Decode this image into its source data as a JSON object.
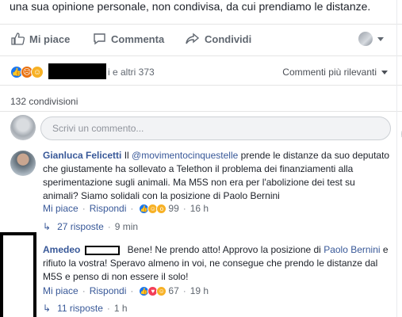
{
  "post": {
    "text_tail": "una sua opinione personale, non condivisa, da cui prendiamo le distanze."
  },
  "actions": {
    "like": "Mi piace",
    "comment": "Commenta",
    "share": "Condividi"
  },
  "reactions": {
    "others": "i e altri 373",
    "sort": "Commenti più rilevanti"
  },
  "shares": "132 condivisioni",
  "composer": {
    "placeholder": "Scrivi un commento..."
  },
  "comments": [
    {
      "author": "Gianluca Felicetti",
      "text_before": " Il ",
      "mention": "@movimentocinquestelle",
      "text_after": " prende le distanze da suo deputato che giustamente ha sollevato a Telethon il problema dei finanziamenti alla sperimentazione sugli animali. Ma M5S non era per l'abolizione dei test su animali? Siamo solidali con la posizione di Paolo Bernini",
      "like": "Mi piace",
      "reply": "Rispondi",
      "reaction_count": "99",
      "time": "16 h",
      "replies": "27 risposte",
      "replies_time": "9 min"
    },
    {
      "author": "Amedeo",
      "text_before": " Bene! Ne prendo atto! Approvo la posizione di ",
      "mention": "Paolo Bernini",
      "text_after": " e rifiuto la vostra! Speravo almeno in voi, ne consegue che prendo le distanze dal M5S e penso di non essere il solo!",
      "like": "Mi piace",
      "reply": "Rispondi",
      "reaction_count": "67",
      "time": "19 h",
      "replies": "11 risposte",
      "replies_time": "1 h"
    }
  ],
  "icons": {
    "like": "thumbs-up-icon",
    "comment": "speech-bubble-icon",
    "share": "share-arrow-icon",
    "emoji": "smiley-icon",
    "camera": "camera-icon",
    "gif": "gif-icon",
    "sticker": "sticker-icon"
  },
  "colors": {
    "link": "#385898",
    "like_blue": "#1877f2",
    "muted": "#606770"
  }
}
